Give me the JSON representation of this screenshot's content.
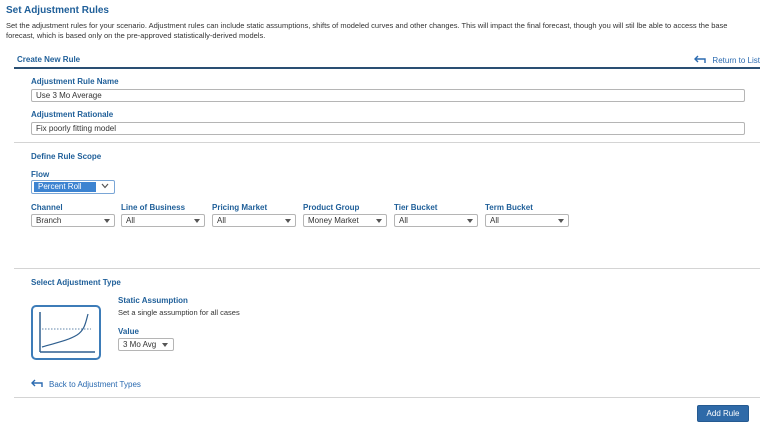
{
  "page": {
    "title": "Set Adjustment Rules",
    "intro": "Set the adjustment rules for your scenario. Adjustment rules can include static assumptions, shifts of modeled curves and other changes. This will impact the final forecast, though you will stil lbe able to access the base forecast, which is based only on the pre-approved statistically-derived models."
  },
  "create_rule": {
    "header": "Create New Rule",
    "return_link": "Return to List",
    "rule_name_label": "Adjustment Rule Name",
    "rule_name_value": "Use 3 Mo Average",
    "rationale_label": "Adjustment Rationale",
    "rationale_value": "Fix poorly fitting model"
  },
  "scope": {
    "heading": "Define Rule Scope",
    "flow_label": "Flow",
    "flow_value": "Percent Roll",
    "filters": [
      {
        "label": "Channel",
        "value": "Branch"
      },
      {
        "label": "Line of Business",
        "value": "All"
      },
      {
        "label": "Pricing Market",
        "value": "All"
      },
      {
        "label": "Product Group",
        "value": "Money Market"
      },
      {
        "label": "Tier Bucket",
        "value": "All"
      },
      {
        "label": "Term Bucket",
        "value": "All"
      }
    ]
  },
  "adjustment_type": {
    "heading": "Select Adjustment Type",
    "type_title": "Static Assumption",
    "type_desc": "Set a single assumption for all cases",
    "value_label": "Value",
    "value_selected": "3 Mo Avg",
    "back_link": "Back to Adjustment Types",
    "graph_icon": "curve-chart-icon"
  },
  "actions": {
    "add_rule": "Add Rule"
  },
  "colors": {
    "heading": "#1f5f99",
    "link": "#2a6ab0",
    "button": "#2f6aa8",
    "selected": "#3c83d1"
  }
}
